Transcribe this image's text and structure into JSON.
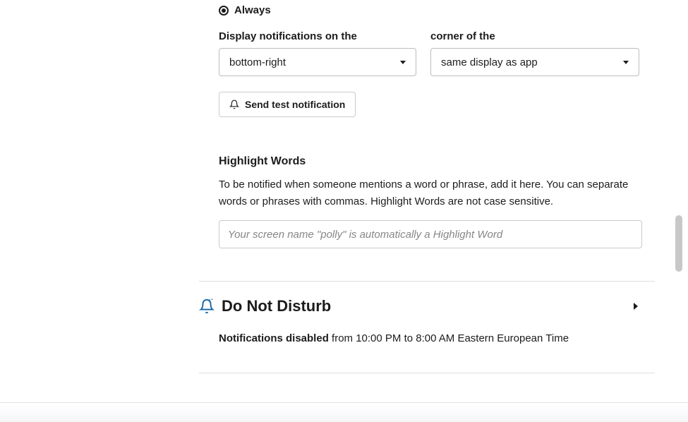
{
  "radio": {
    "always_label": "Always"
  },
  "display": {
    "label_part1": "Display notifications on the",
    "label_part2": "corner of the",
    "position_value": "bottom-right",
    "display_value": "same display as app"
  },
  "test_button_label": "Send test notification",
  "highlight": {
    "title": "Highlight Words",
    "description": "To be notified when someone mentions a word or phrase, add it here. You can separate words or phrases with commas. Highlight Words are not case sensitive.",
    "placeholder": "Your screen name \"polly\" is automatically a Highlight Word"
  },
  "dnd": {
    "title": "Do Not Disturb",
    "status_strong": "Notifications disabled",
    "status_rest": " from 10:00 PM to 8:00 AM Eastern European Time"
  }
}
